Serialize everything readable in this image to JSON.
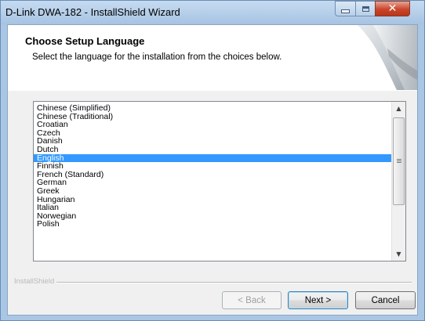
{
  "window": {
    "title": "D-Link DWA-182 - InstallShield Wizard"
  },
  "header": {
    "title": "Choose Setup Language",
    "subtitle": "Select the language for the installation from the choices below."
  },
  "languages": {
    "items": [
      "Chinese (Simplified)",
      "Chinese (Traditional)",
      "Croatian",
      "Czech",
      "Danish",
      "Dutch",
      "English",
      "Finnish",
      "French (Standard)",
      "German",
      "Greek",
      "Hungarian",
      "Italian",
      "Norwegian",
      "Polish"
    ],
    "selected": "English"
  },
  "footer": {
    "brand": "InstallShield"
  },
  "buttons": {
    "back": "< Back",
    "next": "Next >",
    "cancel": "Cancel"
  },
  "colors": {
    "selection": "#3399ff",
    "close_button": "#c9462c"
  },
  "icons": {
    "minimize": "minimize-icon",
    "maximize": "maximize-icon",
    "close": "close-icon",
    "scroll_up": "scroll-up-arrow-icon",
    "scroll_down": "scroll-down-arrow-icon"
  }
}
